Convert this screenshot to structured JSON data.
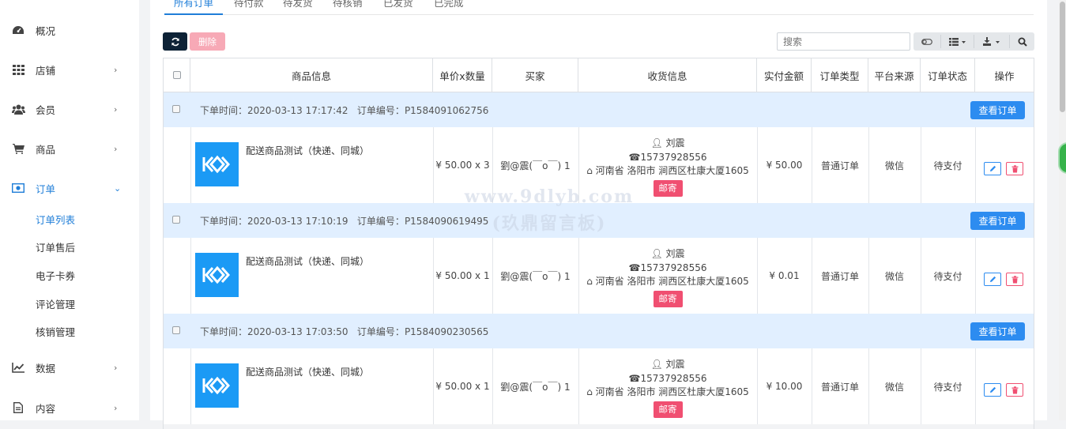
{
  "sidebar": {
    "items": [
      {
        "label": "概况",
        "icon": "dashboard-icon",
        "has_children": false
      },
      {
        "label": "店铺",
        "icon": "grid-icon",
        "has_children": true
      },
      {
        "label": "会员",
        "icon": "users-icon",
        "has_children": true
      },
      {
        "label": "商品",
        "icon": "cart-icon",
        "has_children": true
      },
      {
        "label": "订单",
        "icon": "money-icon",
        "has_children": true,
        "expanded": true
      },
      {
        "label": "数据",
        "icon": "chart-icon",
        "has_children": true
      },
      {
        "label": "内容",
        "icon": "document-icon",
        "has_children": true
      }
    ],
    "order_sub": [
      "订单列表",
      "订单售后",
      "电子卡券",
      "评论管理",
      "核销管理"
    ],
    "active_sub": "订单列表"
  },
  "tabs": [
    "所有订单",
    "待付款",
    "待发货",
    "待核销",
    "已发货",
    "已完成"
  ],
  "toolbar": {
    "delete_label": "删除",
    "search_placeholder": "搜索"
  },
  "table": {
    "columns": [
      "商品信息",
      "单价x数量",
      "买家",
      "收货信息",
      "实付金额",
      "订单类型",
      "平台来源",
      "订单状态",
      "操作"
    ],
    "order_time_label": "下单时间：",
    "order_no_label": "订单编号：",
    "view_order_label": "查看订单",
    "orders": [
      {
        "time": "2020-03-13 17:17:42",
        "order_no": "P1584091062756",
        "product_name": "配送商品测试（快递、同城）",
        "price_qty": "¥ 50.00 x 3",
        "buyer": "劉@震(￣o￣) 1",
        "receiver_name": "刘震",
        "receiver_phone": "15737928556",
        "receiver_address": "河南省 洛阳市 涧西区杜康大厦1605",
        "delivery_badge": "邮寄",
        "paid": "¥ 50.00",
        "order_type": "普通订单",
        "platform": "微信",
        "status": "待支付"
      },
      {
        "time": "2020-03-13 17:10:19",
        "order_no": "P1584090619495",
        "product_name": "配送商品测试（快递、同城）",
        "price_qty": "¥ 50.00 x 1",
        "buyer": "劉@震(￣o￣) 1",
        "receiver_name": "刘震",
        "receiver_phone": "15737928556",
        "receiver_address": "河南省 洛阳市 涧西区杜康大厦1605",
        "delivery_badge": "邮寄",
        "paid": "¥ 0.01",
        "order_type": "普通订单",
        "platform": "微信",
        "status": "待支付"
      },
      {
        "time": "2020-03-13 17:03:50",
        "order_no": "P1584090230565",
        "product_name": "配送商品测试（快递、同城）",
        "price_qty": "¥ 50.00 x 1",
        "buyer": "劉@震(￣o￣) 1",
        "receiver_name": "刘震",
        "receiver_phone": "15737928556",
        "receiver_address": "河南省 洛阳市 涧西区杜康大厦1605",
        "delivery_badge": "邮寄",
        "paid": "¥ 10.00",
        "order_type": "普通订单",
        "platform": "微信",
        "status": "待支付"
      }
    ]
  },
  "watermark": {
    "line1": "www.9dlyb.com",
    "line2": "(玖鼎留言板)"
  },
  "colors": {
    "accent": "#1f7ed8",
    "primary_button": "#2d8cf0",
    "danger": "#f04f71",
    "group_row_bg": "#e1efff",
    "refresh_button": "#0d2236"
  }
}
